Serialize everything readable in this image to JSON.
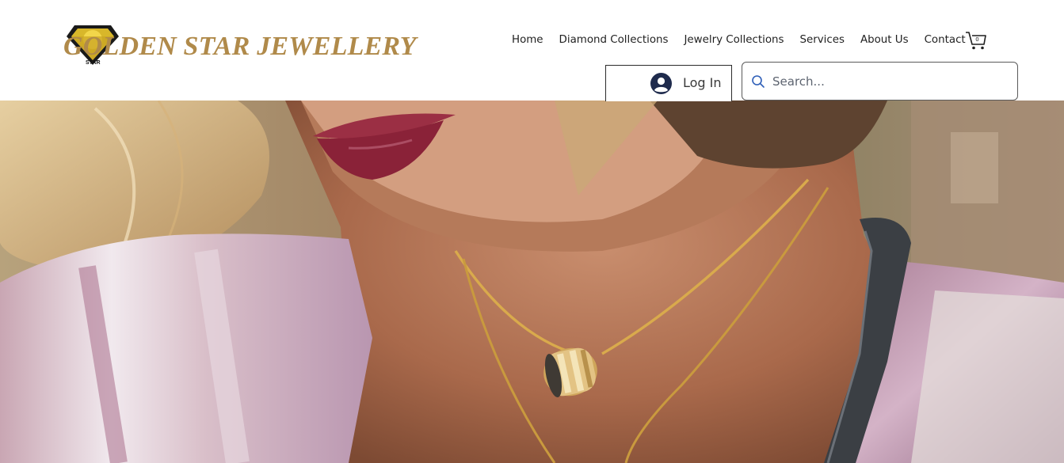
{
  "brand": {
    "name": "GOLDEN STAR JEWELLERY",
    "emblem_text": "STAR",
    "color": "#b08a4a"
  },
  "nav": {
    "items": [
      {
        "label": "Home"
      },
      {
        "label": "Diamond Collections"
      },
      {
        "label": "Jewelry Collections"
      },
      {
        "label": "Services"
      },
      {
        "label": "About Us"
      },
      {
        "label": "Contact"
      }
    ]
  },
  "cart": {
    "icon": "shopping-cart-icon",
    "count": "0"
  },
  "login": {
    "label": "Log In",
    "icon": "user-avatar-icon"
  },
  "search": {
    "placeholder": "Search...",
    "value": "",
    "icon": "search-icon"
  },
  "hero": {
    "image": "close-up photo of a woman wearing layered gold chain necklaces with a gold ring pendant"
  },
  "colors": {
    "accent": "#b08a4a",
    "header_bg": "#ffffff",
    "text": "#1f1f1f",
    "search_icon": "#2f5fb8",
    "avatar": "#1f2b4d"
  }
}
